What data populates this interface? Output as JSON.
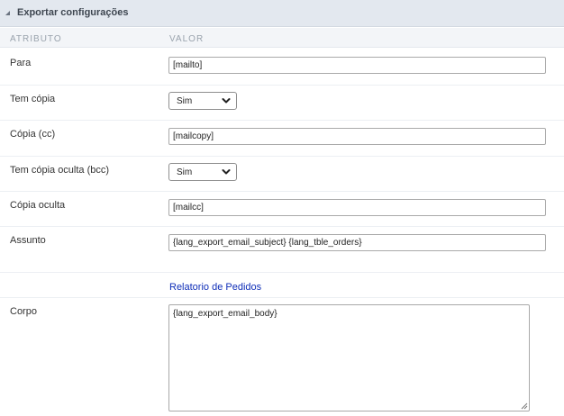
{
  "panel": {
    "title": "Exportar configurações",
    "columns": {
      "attribute": "ATRIBUTO",
      "value": "VALOR"
    }
  },
  "fields": {
    "para": {
      "label": "Para",
      "value": "[mailto]"
    },
    "tem_copia": {
      "label": "Tem cópia",
      "selected": "Sim"
    },
    "copia_cc": {
      "label": "Cópia (cc)",
      "value": "[mailcopy]"
    },
    "tem_copia_oculta": {
      "label": "Tem cópia oculta (bcc)",
      "selected": "Sim"
    },
    "copia_oculta": {
      "label": "Cópia oculta",
      "value": "[mailcc]"
    },
    "assunto": {
      "label": "Assunto",
      "value": "{lang_export_email_subject} {lang_tble_orders}"
    },
    "link": {
      "text": "Relatorio de Pedidos"
    },
    "corpo": {
      "label": "Corpo",
      "value": "{lang_export_email_body}"
    }
  },
  "icons": {
    "header": "collapse-triangle-icon",
    "select": "chevron-down-icon",
    "textarea": "resize-grip-icon"
  },
  "colors": {
    "header_bg": "#e3e8ef",
    "column_header_bg": "#f3f5f8",
    "link": "#0f2eb8",
    "border": "#a9a9a9"
  }
}
